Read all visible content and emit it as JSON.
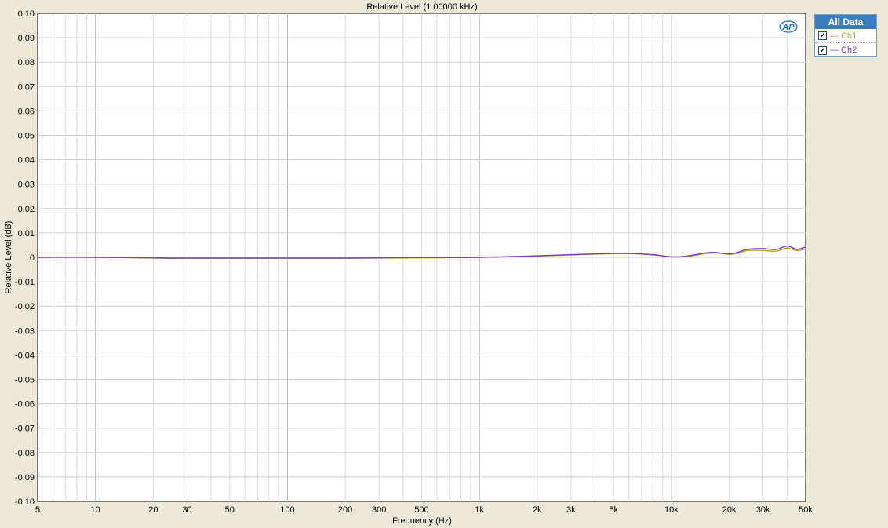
{
  "chart_data": {
    "type": "line",
    "title": "Relative Level (1.00000 kHz)",
    "xlabel": "Frequency (Hz)",
    "ylabel": "Relative Level (dB)",
    "xscale": "log",
    "xlim": [
      5,
      50000
    ],
    "ylim": [
      -0.1,
      0.1
    ],
    "grid": true,
    "x_ticks": [
      5,
      10,
      20,
      30,
      50,
      100,
      200,
      300,
      500,
      1000,
      2000,
      3000,
      5000,
      10000,
      20000,
      30000,
      50000
    ],
    "x_tick_labels": [
      "5",
      "10",
      "20",
      "30",
      "50",
      "100",
      "200",
      "300",
      "500",
      "1k",
      "2k",
      "3k",
      "5k",
      "10k",
      "20k",
      "30k",
      "50k"
    ],
    "y_ticks": [
      0.1,
      0.09,
      0.08,
      0.07,
      0.06,
      0.05,
      0.04,
      0.03,
      0.02,
      0.01,
      0,
      -0.01,
      -0.02,
      -0.03,
      -0.04,
      -0.05,
      -0.06,
      -0.07,
      -0.08,
      -0.09,
      -0.1
    ],
    "y_tick_labels": [
      "0.10",
      "0.09",
      "0.08",
      "0.07",
      "0.06",
      "0.05",
      "0.04",
      "0.03",
      "0.02",
      "0.01",
      "0",
      "-0.01",
      "-0.02",
      "-0.03",
      "-0.04",
      "-0.05",
      "-0.06",
      "-0.07",
      "-0.08",
      "-0.09",
      "-0.10"
    ],
    "legend_position": "outside-right",
    "series": [
      {
        "name": "Ch1",
        "color": "#b5a32a",
        "x": [
          5,
          10,
          20,
          25,
          30,
          50,
          100,
          200,
          300,
          500,
          1000,
          2000,
          3000,
          5000,
          6000,
          8000,
          10000,
          12000,
          15000,
          17000,
          20000,
          22000,
          25000,
          30000,
          35000,
          40000,
          45000,
          50000
        ],
        "y": [
          0,
          0,
          -0.0003,
          -0.0005,
          -0.0004,
          -0.0004,
          -0.0004,
          -0.0004,
          -0.0003,
          -0.0002,
          0,
          0.0005,
          0.001,
          0.0015,
          0.0015,
          0.001,
          0.0002,
          0.0003,
          0.0015,
          0.0018,
          0.0012,
          0.0016,
          0.0028,
          0.0028,
          0.0025,
          0.0038,
          0.0028,
          0.0034
        ]
      },
      {
        "name": "Ch2",
        "color": "#7a3fc0",
        "x": [
          5,
          10,
          20,
          25,
          30,
          50,
          100,
          200,
          300,
          500,
          1000,
          2000,
          3000,
          5000,
          6000,
          8000,
          10000,
          12000,
          15000,
          17000,
          20000,
          22000,
          25000,
          30000,
          35000,
          40000,
          45000,
          50000
        ],
        "y": [
          0,
          0,
          -0.0002,
          -0.0003,
          -0.0003,
          -0.0003,
          -0.0003,
          -0.0003,
          -0.0002,
          -0.0001,
          0,
          0.0006,
          0.0011,
          0.0016,
          0.0016,
          0.0011,
          0.0002,
          0.0005,
          0.0018,
          0.002,
          0.0014,
          0.002,
          0.0033,
          0.0036,
          0.0032,
          0.0046,
          0.0033,
          0.0042
        ]
      }
    ]
  },
  "legend": {
    "header": "All Data",
    "items": [
      {
        "label": "— Ch1",
        "color": "#b5a32a",
        "checked": "✔"
      },
      {
        "label": "— Ch2",
        "color": "#7a3fc0",
        "checked": "✔"
      }
    ]
  },
  "logo": {
    "text": "AP",
    "color": "#1f6fbf"
  }
}
